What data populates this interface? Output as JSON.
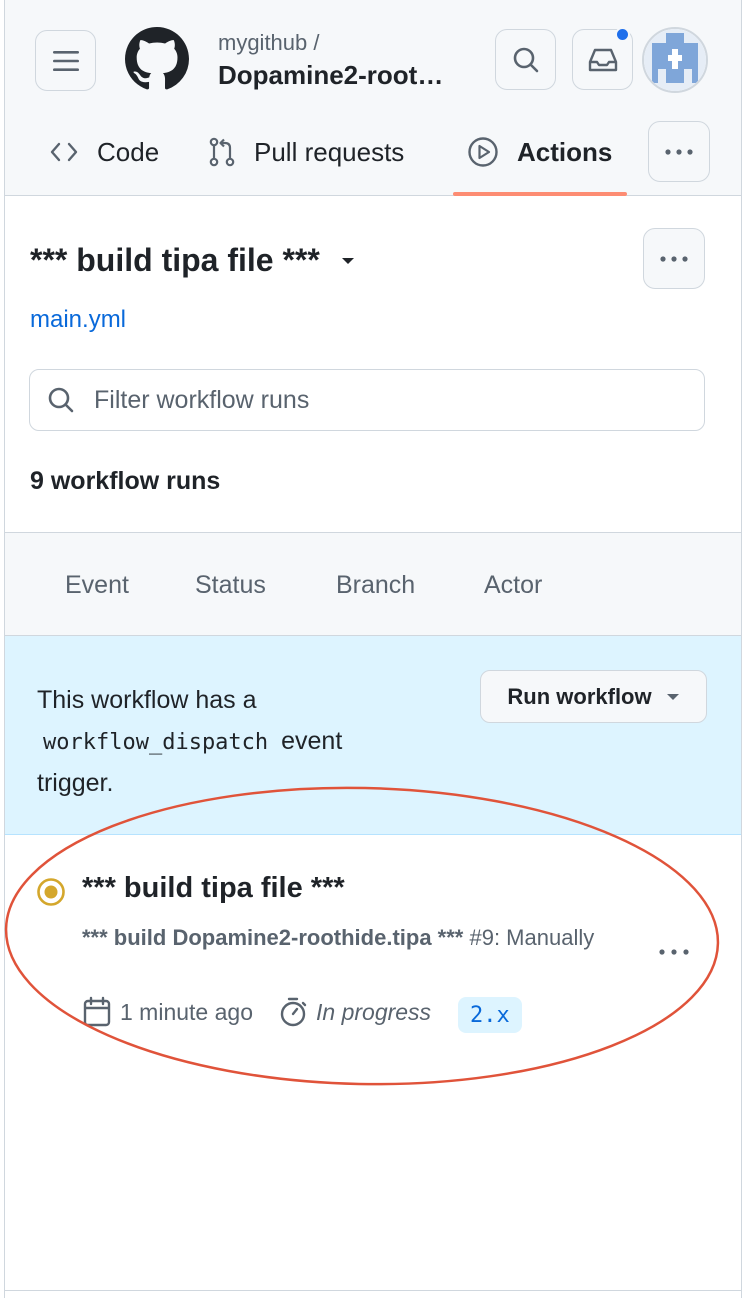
{
  "header": {
    "owner": "mygithub /",
    "repo": "Dopamine2-root…",
    "menu_icon": "hamburger-icon",
    "logo": "github-logo",
    "search_icon": "search-icon",
    "inbox_icon": "inbox-icon",
    "avatar": "user-avatar"
  },
  "tabs": [
    {
      "label": "Code",
      "icon": "code-icon"
    },
    {
      "label": "Pull requests",
      "icon": "git-pull-request-icon"
    },
    {
      "label": "Actions",
      "icon": "play-icon",
      "selected": true
    }
  ],
  "workflow": {
    "title": "*** build tipa file ***",
    "file": "main.yml",
    "filter_placeholder": "Filter workflow runs",
    "runs_count": "9 workflow runs"
  },
  "filters": [
    "Event",
    "Status",
    "Branch",
    "Actor"
  ],
  "banner": {
    "text_before": "This workflow has a",
    "code": "workflow_dispatch",
    "text_after": "event",
    "text_end": "trigger.",
    "run_button": "Run workflow"
  },
  "run": {
    "title": "*** build tipa file ***",
    "subtitle_bold": "*** build Dopamine2-roothide.tipa ***",
    "subtitle_rest": " #9: Manually",
    "time": "1 minute ago",
    "duration": "In progress",
    "branch": "2.x",
    "status": "in-progress"
  },
  "colors": {
    "accent": "#0969da",
    "tab_underline": "#fd8c73",
    "status_yellow": "#d4a72c",
    "annotation_red": "#e0533a",
    "banner_bg": "#ddf4ff"
  }
}
